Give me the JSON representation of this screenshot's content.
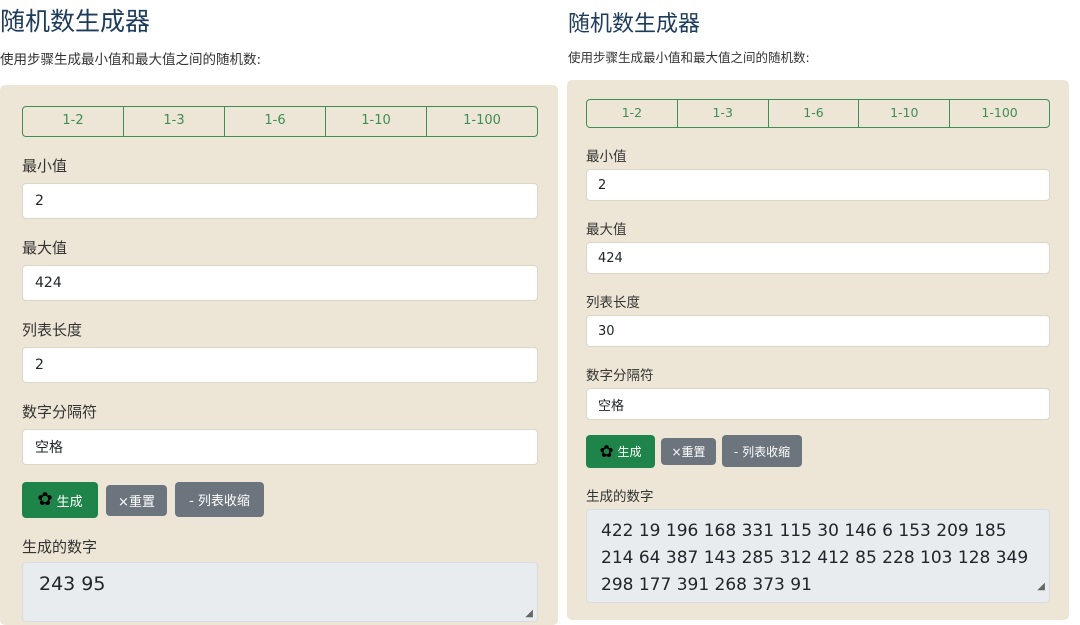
{
  "panels": [
    {
      "title": "随机数生成器",
      "subtitle": "使用步骤生成最小值和最大值之间的随机数:",
      "ranges": [
        "1-2",
        "1-3",
        "1-6",
        "1-10",
        "1-100"
      ],
      "min_label": "最小值",
      "min_value": "2",
      "max_label": "最大值",
      "max_value": "424",
      "len_label": "列表长度",
      "len_value": "2",
      "sep_label": "数字分隔符",
      "sep_value": "空格",
      "generate": "生成",
      "reset": "×重置",
      "collapse": "- 列表收缩",
      "output_label": "生成的数字",
      "output": "243 95"
    },
    {
      "title": "随机数生成器",
      "subtitle": "使用步骤生成最小值和最大值之间的随机数:",
      "ranges": [
        "1-2",
        "1-3",
        "1-6",
        "1-10",
        "1-100"
      ],
      "min_label": "最小值",
      "min_value": "2",
      "max_label": "最大值",
      "max_value": "424",
      "len_label": "列表长度",
      "len_value": "30",
      "sep_label": "数字分隔符",
      "sep_value": "空格",
      "generate": "生成",
      "reset": "×重置",
      "collapse": "- 列表收缩",
      "output_label": "生成的数字",
      "output": "422 19 196 168 331 115 30 146 6 153 209 185 214 64 387 143 285 312 412 85 228 103 128 349 298 177 391 268 373 91"
    }
  ],
  "colors": {
    "accent": "#1e8449",
    "panel_bg": "#ede6d6",
    "title": "#1d3b5a"
  },
  "icons": {
    "generate": "gear-icon"
  }
}
